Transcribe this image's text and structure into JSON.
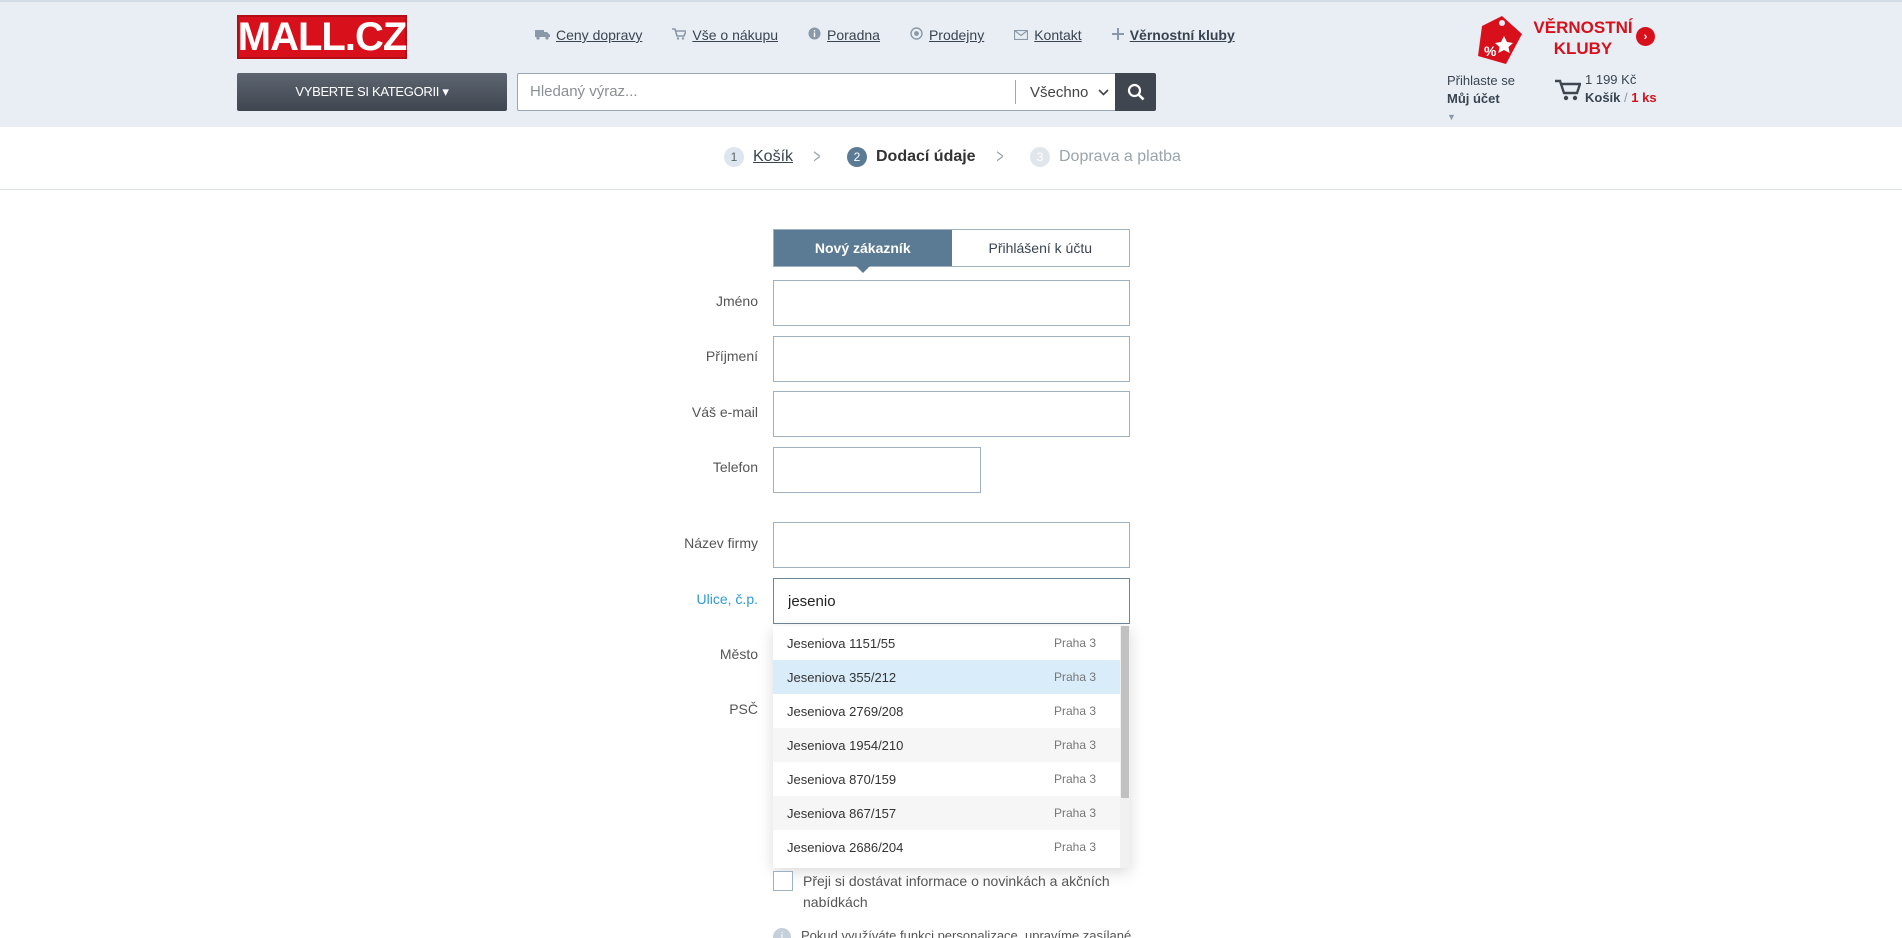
{
  "header": {
    "logo_text": "MALL.CZ",
    "nav": [
      {
        "label": "Ceny dopravy",
        "icon": "truck-icon"
      },
      {
        "label": "Vše o nákupu",
        "icon": "cart-small-icon"
      },
      {
        "label": "Poradna",
        "icon": "info-icon"
      },
      {
        "label": "Prodejny",
        "icon": "location-icon"
      },
      {
        "label": "Kontakt",
        "icon": "mail-icon"
      },
      {
        "label": "Věrnostní kluby",
        "icon": "plus-icon"
      }
    ],
    "loyalty": {
      "line1": "VĚRNOSTNÍ",
      "line2": "KLUBY"
    },
    "category_button": "VYBERTE SI KATEGORII ▾",
    "search": {
      "placeholder": "Hledaný výraz...",
      "scope": "Všechno"
    },
    "account": {
      "line1": "Přihlaste se",
      "line2": "Můj účet"
    },
    "cart": {
      "price": "1 199 Kč",
      "label": "Košík",
      "count": "1 ks"
    }
  },
  "steps": [
    {
      "num": "1",
      "label": "Košík",
      "state": "done"
    },
    {
      "num": "2",
      "label": "Dodací údaje",
      "state": "active"
    },
    {
      "num": "3",
      "label": "Doprava a platba",
      "state": "todo"
    }
  ],
  "form": {
    "tabs": [
      "Nový zákazník",
      "Přihlášení k účtu"
    ],
    "labels": {
      "first_name": "Jméno",
      "last_name": "Příjmení",
      "email": "Váš e-mail",
      "phone": "Telefon",
      "company": "Název firmy",
      "street": "Ulice, č.p.",
      "city": "Město",
      "zip": "PSČ"
    },
    "street_value": "jesenio",
    "suggestions": [
      {
        "street": "Jeseniova 1151/55",
        "city": "Praha 3"
      },
      {
        "street": "Jeseniova 355/212",
        "city": "Praha 3"
      },
      {
        "street": "Jeseniova 2769/208",
        "city": "Praha 3"
      },
      {
        "street": "Jeseniova 1954/210",
        "city": "Praha 3"
      },
      {
        "street": "Jeseniova 870/159",
        "city": "Praha 3"
      },
      {
        "street": "Jeseniova 867/157",
        "city": "Praha 3"
      },
      {
        "street": "Jeseniova 2686/204",
        "city": "Praha 3"
      }
    ],
    "highlighted_index": 1,
    "newsletter_label": "Přeji si dostávat informace o novinkách a akčních nabídkách",
    "info_text": "Pokud využíváte funkci personalizace, upravíme zasílané"
  },
  "colors": {
    "brand_red": "#d8101c",
    "accent_blue": "#5b7a93",
    "focus_blue": "#2f9ad6",
    "highlight": "#d9ecf9"
  }
}
